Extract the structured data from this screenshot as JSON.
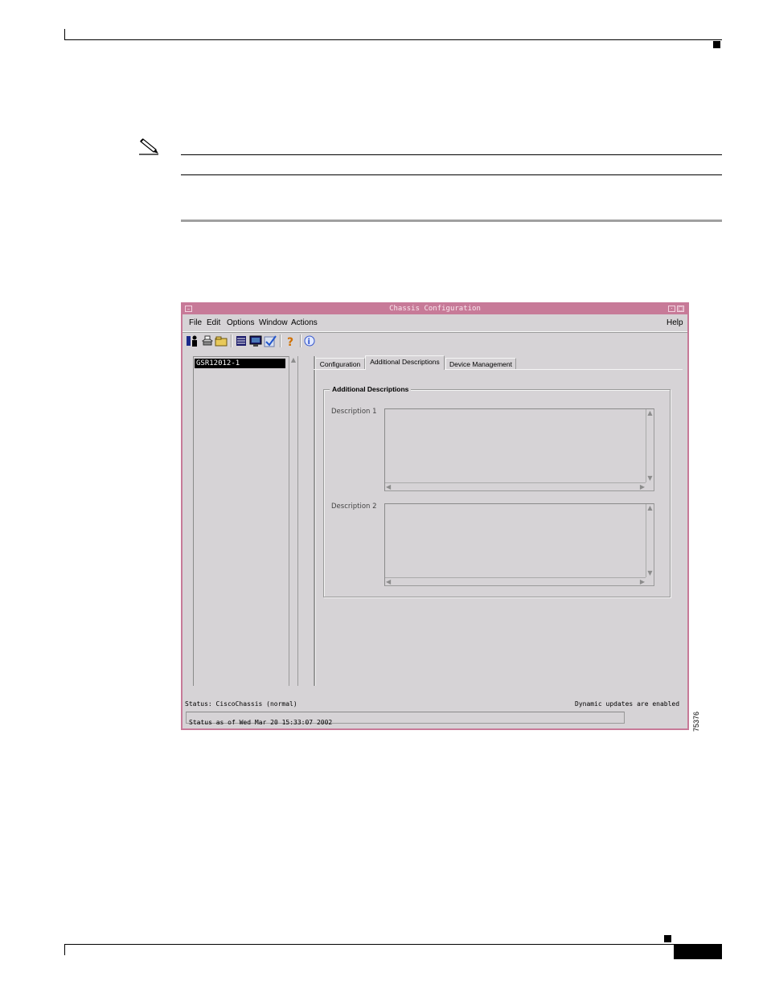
{
  "window": {
    "title": "Chassis Configuration"
  },
  "menu": {
    "file": "File",
    "edit": "Edit",
    "options": "Options",
    "window": "Window",
    "actions": "Actions",
    "help": "Help"
  },
  "toolbar": {
    "icons": [
      "users-icon",
      "printer-icon",
      "folder-icon",
      "list-icon",
      "monitor-icon",
      "checkmark-icon",
      "question-icon",
      "info-icon"
    ]
  },
  "tree": {
    "selected_item": "GSR12012-1"
  },
  "tabs": [
    {
      "label": "Configuration",
      "active": false
    },
    {
      "label": "Additional Descriptions",
      "active": true
    },
    {
      "label": "Device Management",
      "active": false
    }
  ],
  "group": {
    "title": "Additional Descriptions",
    "description1_label": "Description 1",
    "description1_value": "",
    "description2_label": "Description 2",
    "description2_value": ""
  },
  "status": {
    "state_text": "Status: CiscoChassis (normal)",
    "updates_text": "Dynamic updates are enabled",
    "timestamp_text": "Status as of Wed Mar 20 15:33:07 2002"
  },
  "figure_id": "75376",
  "colors": {
    "window_frame": "#c77a98",
    "window_bg": "#d6d3d6",
    "selection": "#000000"
  }
}
